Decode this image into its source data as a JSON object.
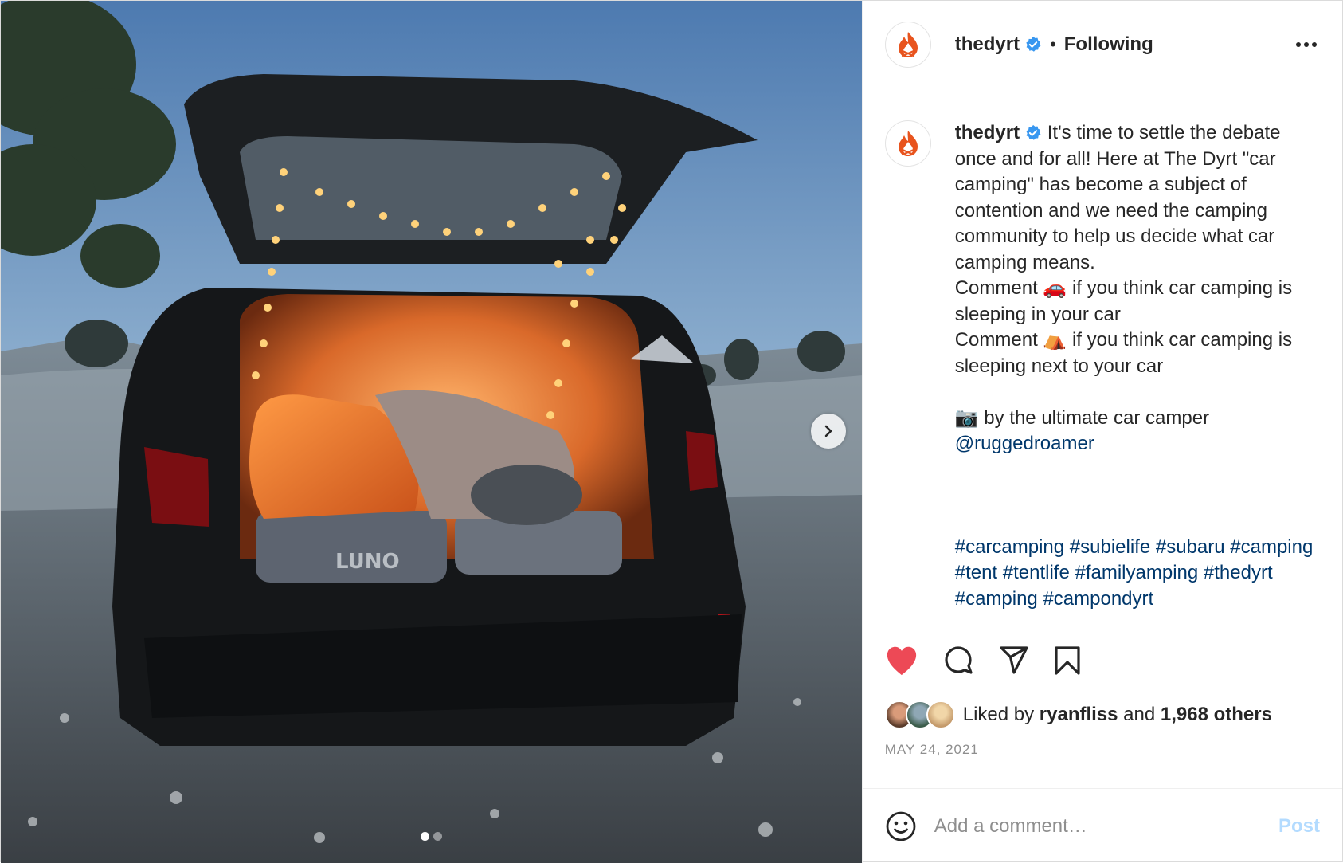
{
  "media": {
    "carousel_dots": 2,
    "active_dot": 0,
    "next_button_icon": "chevron-right-icon",
    "photo_text": "LUNO"
  },
  "header": {
    "username": "thedyrt",
    "verified": true,
    "separator": "•",
    "follow_status": "Following",
    "more_icon": "more-options-icon"
  },
  "caption": {
    "username": "thedyrt",
    "lines": [
      "It's time to settle the debate once and for all! Here at The Dyrt \"car camping\" has become a subject of contention and we need the camping community to help us decide what car camping means.",
      "Comment 🚗 if you think car camping is sleeping in your car",
      "Comment ⛺ if you think car camping is sleeping next to your car"
    ],
    "credit": "📷 by the ultimate car camper",
    "mention": "@ruggedroamer",
    "hashtags": "#carcamping #subielife #subaru #camping #tent #tentlife #familyamping #thedyrt #camping #campondyrt"
  },
  "actions": {
    "liked": true,
    "icons": [
      "heart-icon",
      "comment-icon",
      "share-icon",
      "bookmark-icon"
    ],
    "likes_prefix": "Liked by",
    "liked_by_user": "ryanfliss",
    "likes_and": "and",
    "likes_others": "1,968 others",
    "date": "MAY 24, 2021"
  },
  "comment": {
    "placeholder": "Add a comment…",
    "post_label": "Post"
  },
  "colors": {
    "like_red": "#ed4956",
    "verified_blue": "#3897f0",
    "link_blue": "#00376b",
    "post_disabled": "#b3dbff",
    "brand_orange": "#e8541e"
  }
}
